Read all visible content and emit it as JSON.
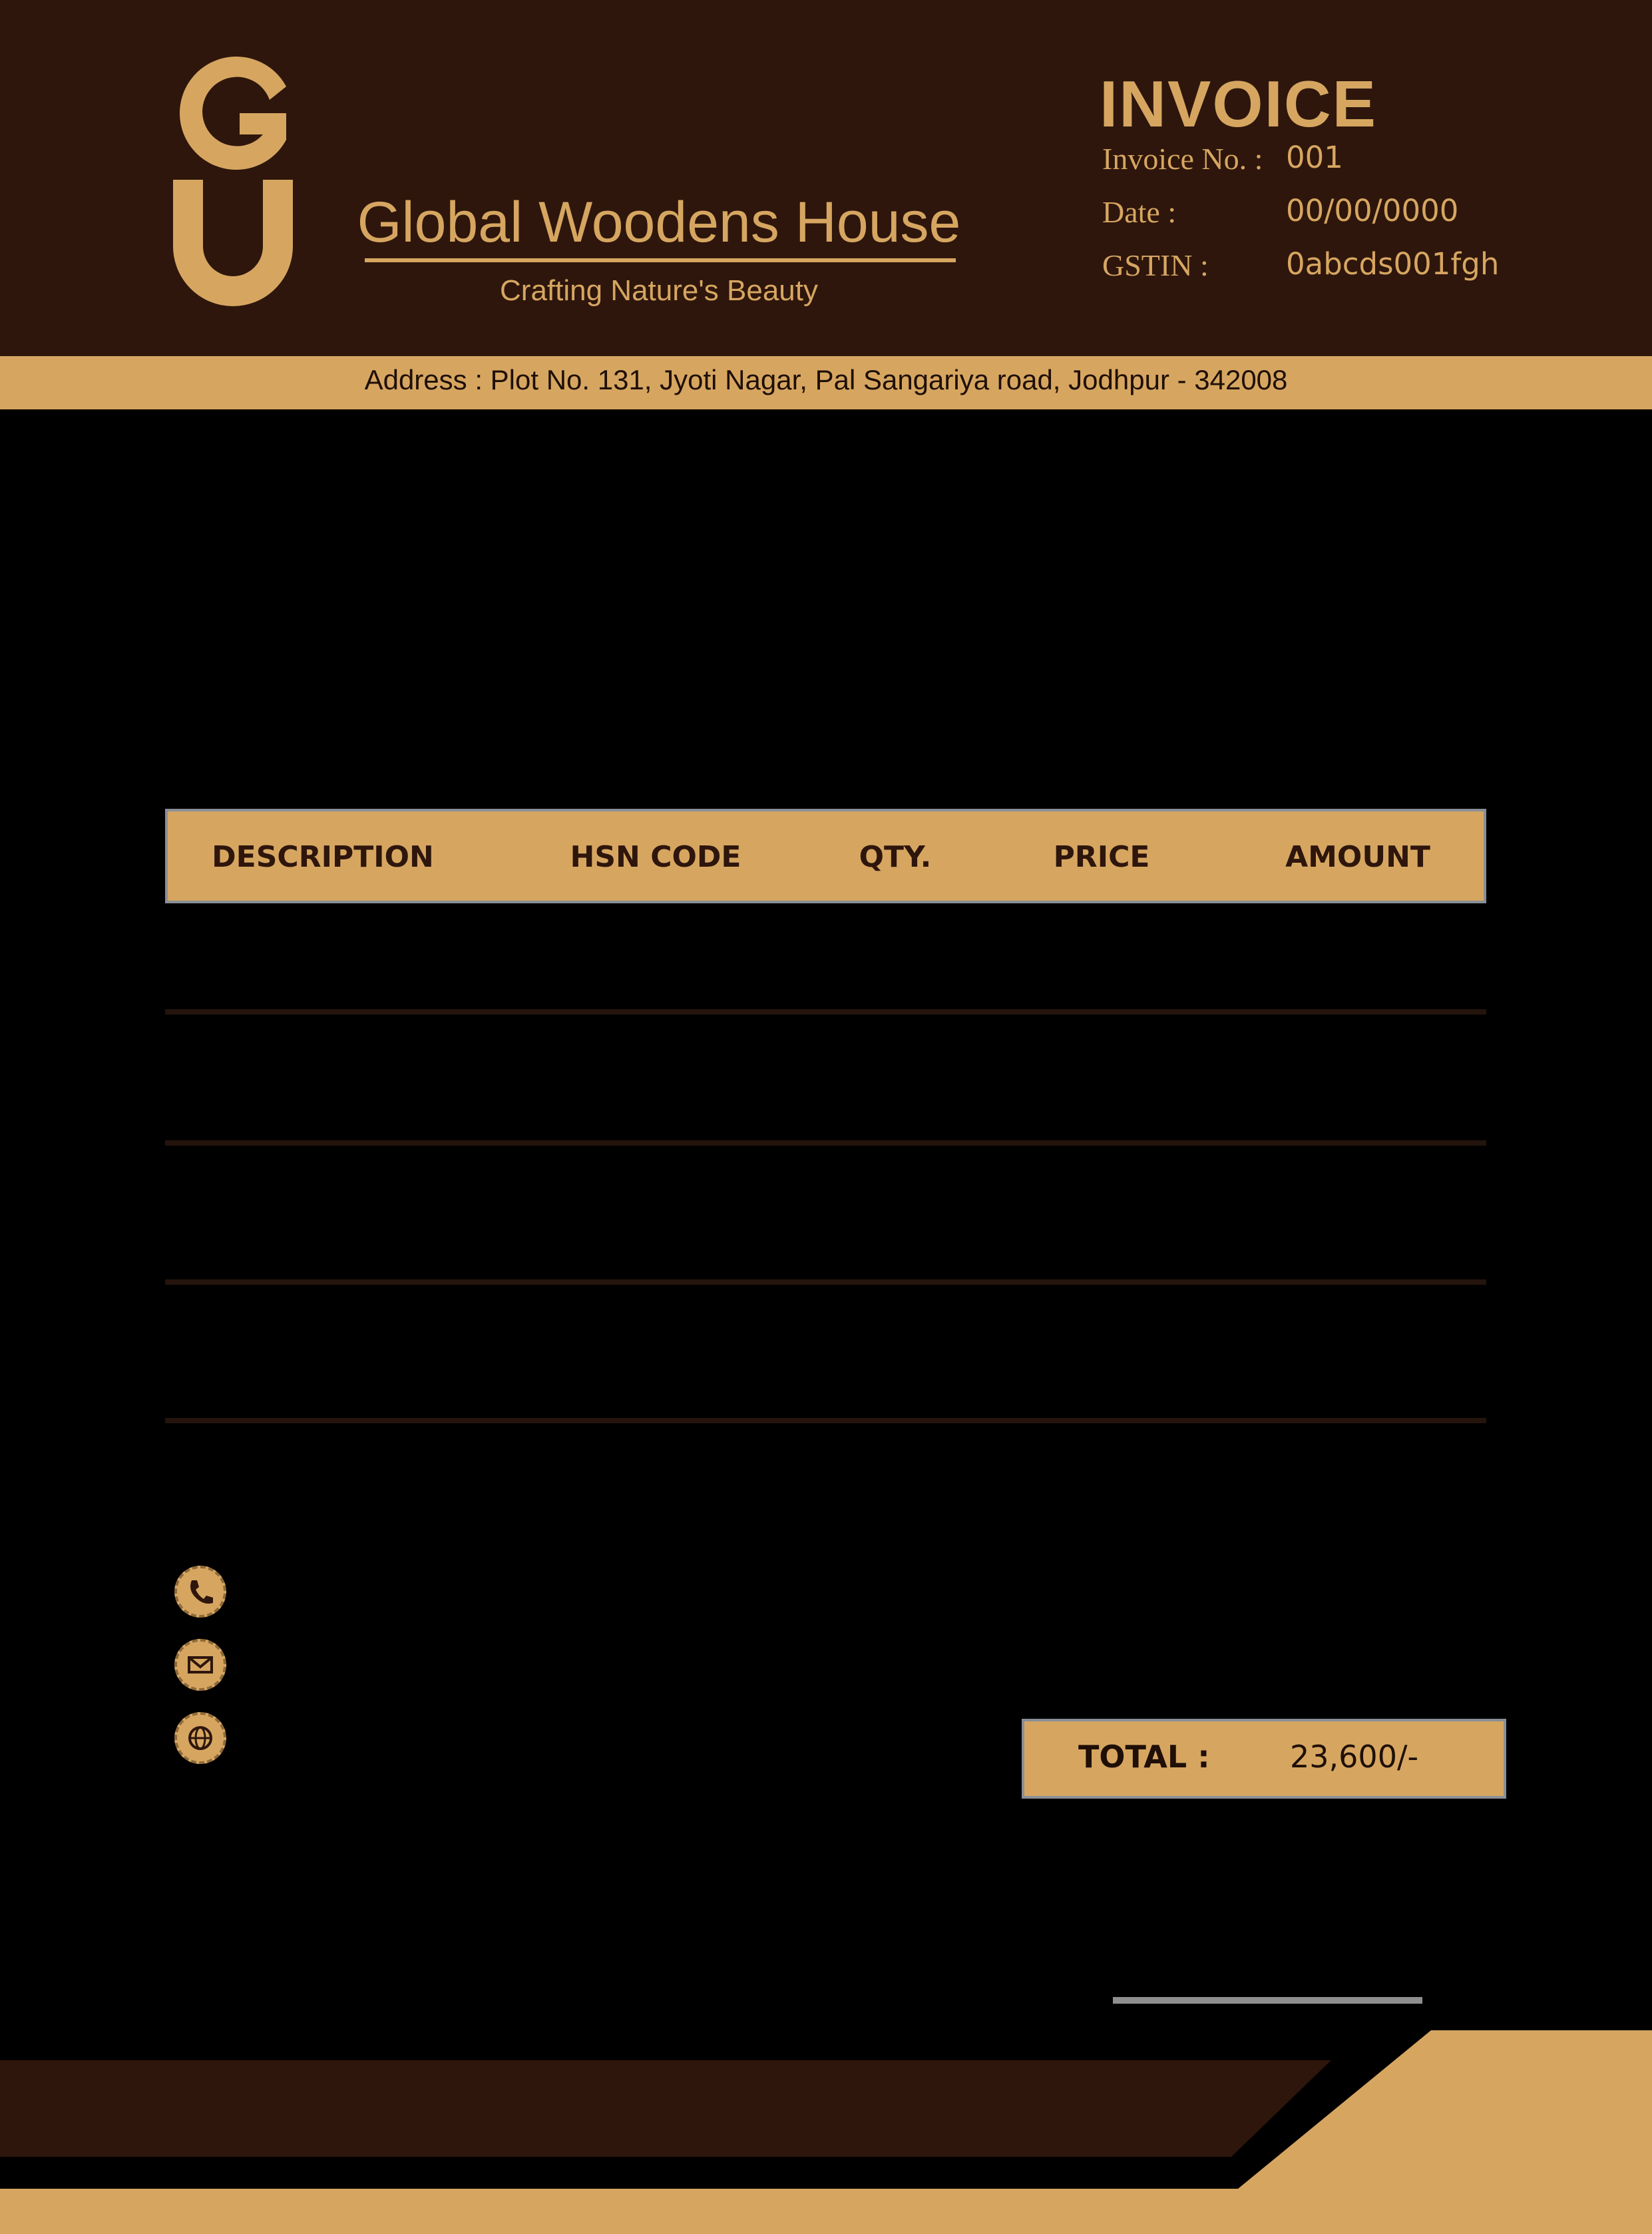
{
  "brand": {
    "logo_text": "GU",
    "name": "Global Woodens House",
    "tagline": "Crafting Nature's Beauty"
  },
  "invoice": {
    "title": "INVOICE",
    "number_label": "Invoice No. :",
    "number_value": "001",
    "date_label": "Date :",
    "date_value": "00/00/0000",
    "gstin_label": "GSTIN :",
    "gstin_value": "0abcds001fgh"
  },
  "address": "Address : Plot No. 131, Jyoti Nagar, Pal Sangariya road, Jodhpur - 342008",
  "table": {
    "headers": [
      "DESCRIPTION",
      "HSN CODE",
      "QTY.",
      "PRICE",
      "AMOUNT"
    ]
  },
  "totals": {
    "total_label": "TOTAL :",
    "total_value": "23,600/-"
  },
  "contact": {
    "icons": [
      "phone-icon",
      "mail-icon",
      "globe-icon"
    ]
  },
  "colors": {
    "header_bg": "#2e160c",
    "accent": "#d6a661",
    "page_bg": "#000000"
  }
}
